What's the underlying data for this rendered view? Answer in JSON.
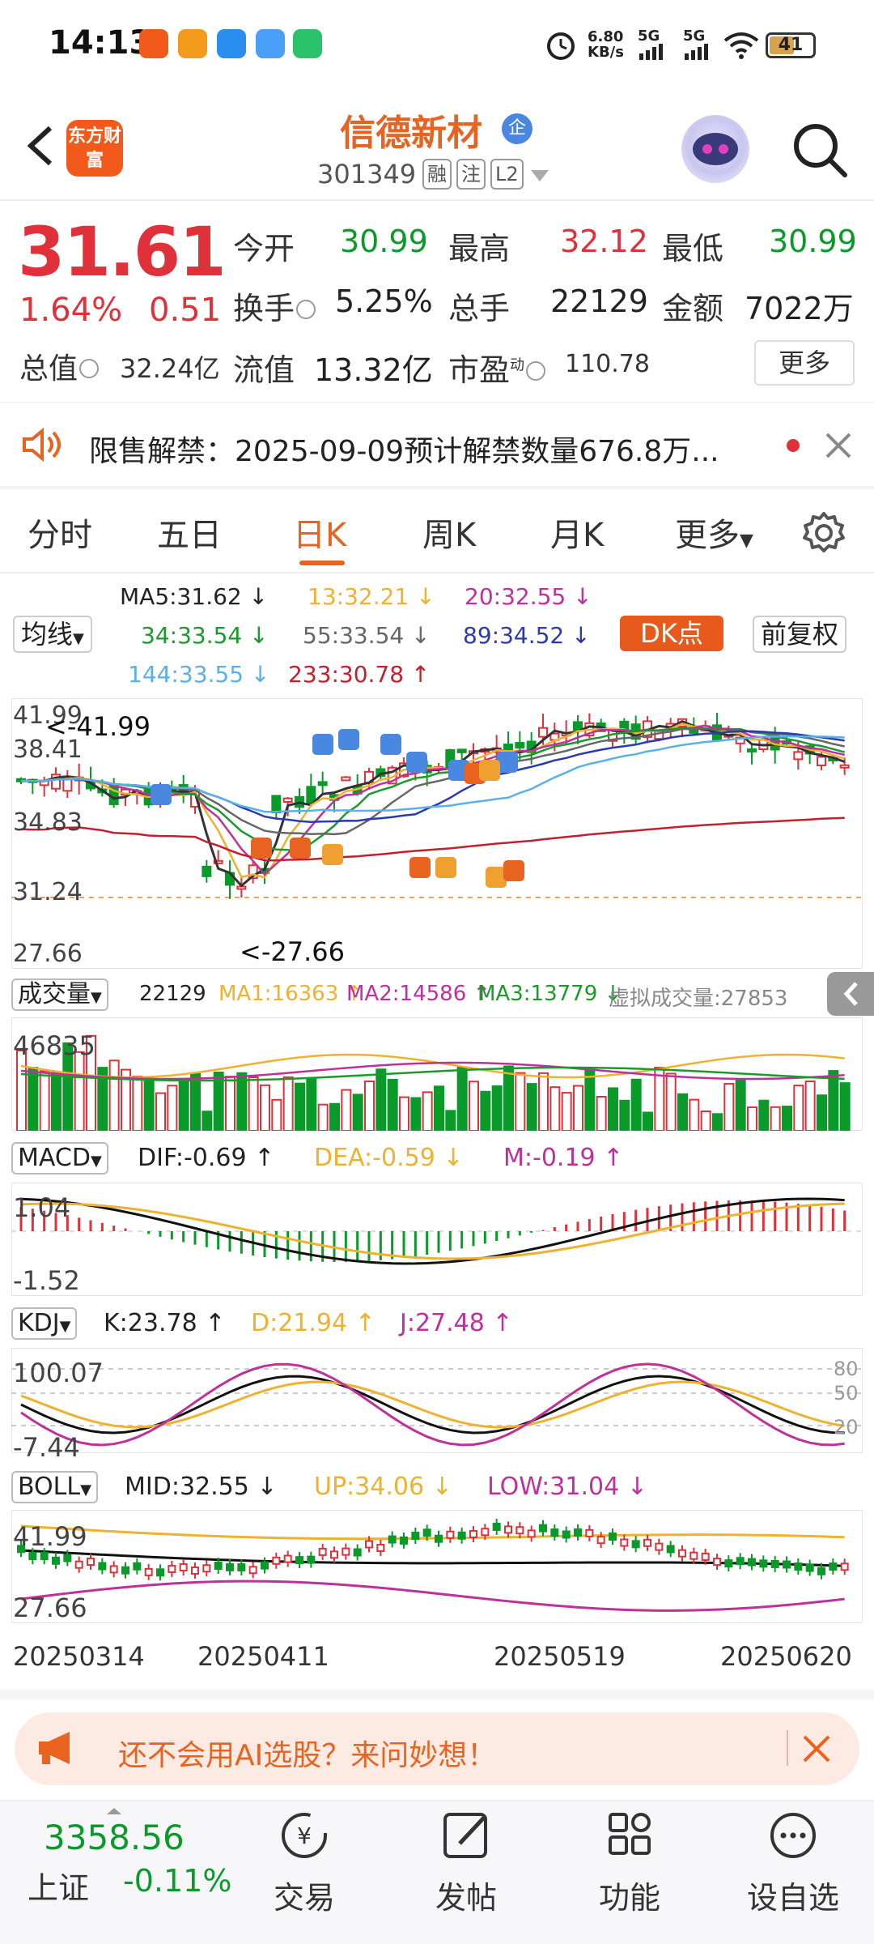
{
  "status_bar": {
    "time": "14:13",
    "net_speed": "6.80",
    "net_unit": "KB/s",
    "sig1": "5G",
    "sig2": "5G",
    "battery": "41"
  },
  "header": {
    "brand": "东方财富",
    "name": "信德新材",
    "badge": "企",
    "code": "301349",
    "tags": [
      "融",
      "注",
      "L2"
    ]
  },
  "quote": {
    "price": "31.61",
    "pct_change": "1.64%",
    "abs_change": "0.51",
    "rows": [
      [
        {
          "label": "今开",
          "value": "30.99",
          "color": "green"
        },
        {
          "label": "最高",
          "value": "32.12",
          "color": "red"
        },
        {
          "label": "最低",
          "value": "30.99",
          "color": "green"
        }
      ],
      [
        {
          "label": "换手",
          "value": "5.25%",
          "color": "black"
        },
        {
          "label": "总手",
          "value": "22129",
          "color": "black"
        },
        {
          "label": "金额",
          "value": "7022万",
          "color": "black"
        }
      ]
    ],
    "total_value_label": "总值",
    "total_value": "32.24亿",
    "float_value_label": "流值",
    "float_value": "13.32亿",
    "pe_label": "市盈",
    "pe_sup": "动",
    "pe_value": "110.78",
    "more_label": "更多"
  },
  "notice": {
    "text": "限售解禁：2025-09-09预计解禁数量676.8万..."
  },
  "tabs": [
    "分时",
    "五日",
    "日K",
    "周K",
    "月K",
    "更多"
  ],
  "ma_legend": {
    "selector": "均线",
    "items": [
      {
        "text": "MA5:31.62 ↓",
        "color": "#333333"
      },
      {
        "text": "13:32.21 ↓",
        "color": "#f0b030"
      },
      {
        "text": "20:32.55 ↓",
        "color": "#c0309a"
      },
      {
        "text": "34:33.54 ↓",
        "color": "#1a9a2a"
      },
      {
        "text": "55:33.54 ↓",
        "color": "#666666"
      },
      {
        "text": "89:34.52 ↓",
        "color": "#2a3ab0"
      },
      {
        "text": "144:33.55 ↓",
        "color": "#5ab0e8"
      },
      {
        "text": "233:30.78 ↑",
        "color": "#c02030"
      }
    ],
    "dk_label": "DK点",
    "adjust_label": "前复权"
  },
  "kchart": {
    "y_labels": [
      "41.99",
      "38.41",
      "34.83",
      "31.24",
      "27.66"
    ],
    "high_marker": "<-41.99",
    "low_marker": "<-27.66"
  },
  "volume": {
    "selector": "成交量",
    "total": "22129",
    "ma1": "MA1:16363 ↑",
    "ma2": "MA2:14586 ↑",
    "ma3": "MA3:13779 ↓",
    "virtual": "虚拟成交量:27853",
    "max_label": "46835"
  },
  "macd": {
    "selector": "MACD",
    "dif": "DIF:-0.69 ↑",
    "dea": "DEA:-0.59 ↓",
    "m": "M:-0.19 ↑",
    "top": "1.04",
    "bottom": "-1.52"
  },
  "kdj": {
    "selector": "KDJ",
    "k": "K:23.78 ↑",
    "d": "D:21.94 ↑",
    "j": "J:27.48 ↑",
    "top": "100.07",
    "bottom": "-7.44",
    "ref": [
      "80",
      "50",
      "20"
    ]
  },
  "boll": {
    "selector": "BOLL",
    "mid": "MID:32.55 ↓",
    "up": "UP:34.06 ↓",
    "low": "LOW:31.04 ↓",
    "top": "41.99",
    "bottom": "27.66"
  },
  "x_dates": [
    "20250314",
    "20250411",
    "20250519",
    "20250620"
  ],
  "promo": {
    "text": "还不会用AI选股？来问妙想！"
  },
  "bottom_nav": {
    "index_value": "3358.56",
    "index_name": "上证",
    "index_change": "-0.11%",
    "items": [
      "交易",
      "发帖",
      "功能",
      "设自选"
    ]
  }
}
